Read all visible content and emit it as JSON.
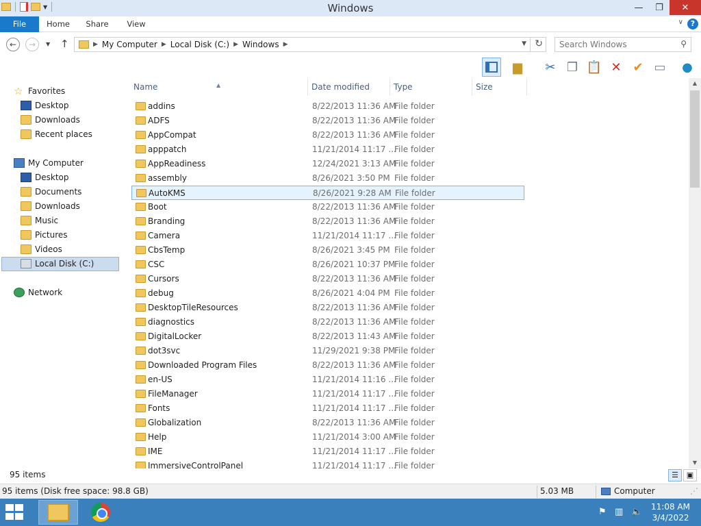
{
  "window": {
    "title": "Windows"
  },
  "ribbon": {
    "tabs": [
      "File",
      "Home",
      "Share",
      "View"
    ],
    "help": "?"
  },
  "address": {
    "crumbs": [
      "My Computer",
      "Local Disk (C:)",
      "Windows"
    ]
  },
  "search": {
    "placeholder": "Search Windows"
  },
  "nav": {
    "favorites": "Favorites",
    "fav_items": [
      "Desktop",
      "Downloads",
      "Recent places"
    ],
    "computer": "My Computer",
    "computer_items": [
      "Desktop",
      "Documents",
      "Downloads",
      "Music",
      "Pictures",
      "Videos",
      "Local Disk (C:)"
    ],
    "network": "Network"
  },
  "columns": {
    "name": "Name",
    "date": "Date modified",
    "type": "Type",
    "size": "Size"
  },
  "files": [
    {
      "name": "addins",
      "date": "8/22/2013 11:36 AM",
      "type": "File folder"
    },
    {
      "name": "ADFS",
      "date": "8/22/2013 11:36 AM",
      "type": "File folder"
    },
    {
      "name": "AppCompat",
      "date": "8/22/2013 11:36 AM",
      "type": "File folder"
    },
    {
      "name": "apppatch",
      "date": "11/21/2014 11:17 ...",
      "type": "File folder"
    },
    {
      "name": "AppReadiness",
      "date": "12/24/2021 3:13 AM",
      "type": "File folder"
    },
    {
      "name": "assembly",
      "date": "8/26/2021 3:50 PM",
      "type": "File folder"
    },
    {
      "name": "AutoKMS",
      "date": "8/26/2021 9:28 AM",
      "type": "File folder"
    },
    {
      "name": "Boot",
      "date": "8/22/2013 11:36 AM",
      "type": "File folder"
    },
    {
      "name": "Branding",
      "date": "8/22/2013 11:36 AM",
      "type": "File folder"
    },
    {
      "name": "Camera",
      "date": "11/21/2014 11:17 ...",
      "type": "File folder"
    },
    {
      "name": "CbsTemp",
      "date": "8/26/2021 3:45 PM",
      "type": "File folder"
    },
    {
      "name": "CSC",
      "date": "8/26/2021 10:37 PM",
      "type": "File folder"
    },
    {
      "name": "Cursors",
      "date": "8/22/2013 11:36 AM",
      "type": "File folder"
    },
    {
      "name": "debug",
      "date": "8/26/2021 4:04 PM",
      "type": "File folder"
    },
    {
      "name": "DesktopTileResources",
      "date": "8/22/2013 11:36 AM",
      "type": "File folder"
    },
    {
      "name": "diagnostics",
      "date": "8/22/2013 11:36 AM",
      "type": "File folder"
    },
    {
      "name": "DigitalLocker",
      "date": "8/22/2013 11:43 AM",
      "type": "File folder"
    },
    {
      "name": "dot3svc",
      "date": "11/29/2021 9:38 PM",
      "type": "File folder"
    },
    {
      "name": "Downloaded Program Files",
      "date": "8/22/2013 11:36 AM",
      "type": "File folder"
    },
    {
      "name": "en-US",
      "date": "11/21/2014 11:16 ...",
      "type": "File folder"
    },
    {
      "name": "FileManager",
      "date": "11/21/2014 11:17 ...",
      "type": "File folder"
    },
    {
      "name": "Fonts",
      "date": "11/21/2014 11:17 ...",
      "type": "File folder"
    },
    {
      "name": "Globalization",
      "date": "8/22/2013 11:36 AM",
      "type": "File folder"
    },
    {
      "name": "Help",
      "date": "11/21/2014 3:00 AM",
      "type": "File folder"
    },
    {
      "name": "IME",
      "date": "11/21/2014 11:17 ...",
      "type": "File folder"
    },
    {
      "name": "ImmersiveControlPanel",
      "date": "11/21/2014 11:17 ...",
      "type": "File folder"
    }
  ],
  "selected_index": 6,
  "status": {
    "item_count": "95 items",
    "disk_info": "95 items (Disk free space: 98.8 GB)",
    "size": "5.03 MB",
    "location": "Computer"
  },
  "clock": {
    "time": "11:08 AM",
    "date": "3/4/2022"
  }
}
